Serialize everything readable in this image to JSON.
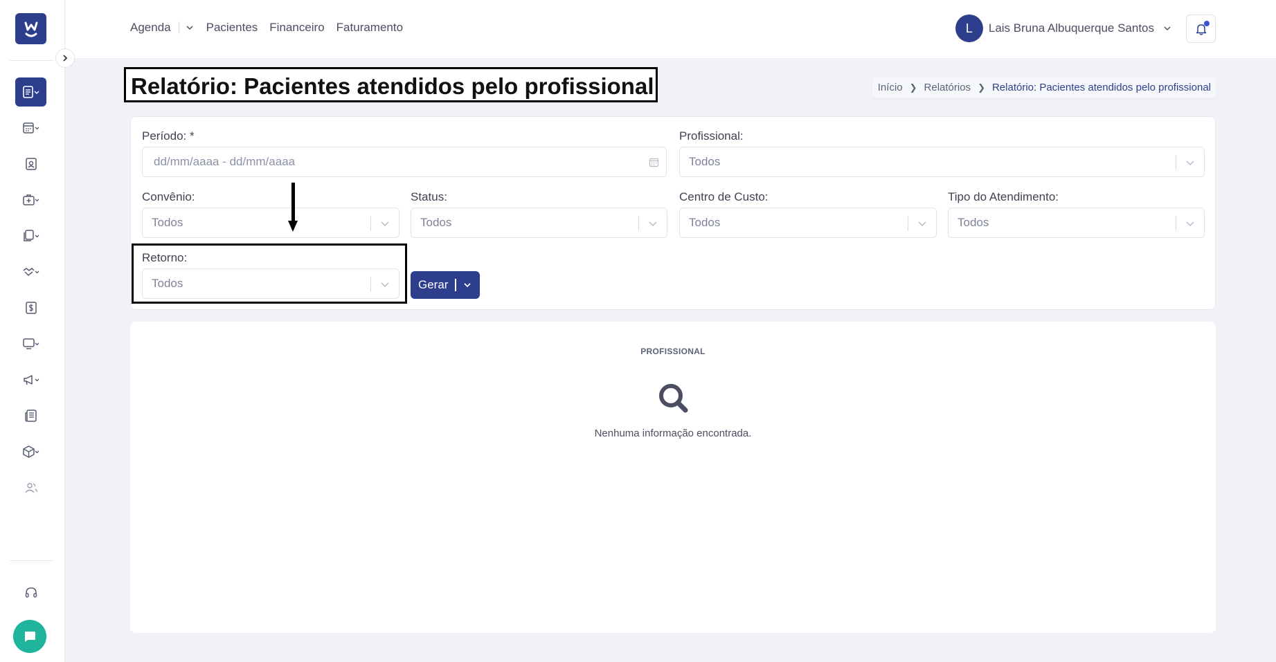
{
  "nav": {
    "items": [
      "Agenda",
      "Pacientes",
      "Financeiro",
      "Faturamento"
    ]
  },
  "user": {
    "initial": "L",
    "name": "Lais Bruna Albuquerque Santos"
  },
  "page": {
    "title": "Relatório: Pacientes atendidos pelo profissional"
  },
  "breadcrumb": [
    "Início",
    "Relatórios",
    "Relatório: Pacientes atendidos pelo profissional"
  ],
  "filters": {
    "periodo_label": "Período: *",
    "periodo_placeholder": "dd/mm/aaaa - dd/mm/aaaa",
    "profissional_label": "Profissional:",
    "profissional_value": "Todos",
    "convenio_label": "Convênio:",
    "convenio_value": "Todos",
    "status_label": "Status:",
    "status_value": "Todos",
    "centro_label": "Centro de Custo:",
    "centro_value": "Todos",
    "tipo_label": "Tipo do Atendimento:",
    "tipo_value": "Todos",
    "retorno_label": "Retorno:",
    "retorno_value": "Todos",
    "gerar_label": "Gerar"
  },
  "results": {
    "header": "PROFISSIONAL",
    "empty_message": "Nenhuma informação encontrada."
  },
  "colors": {
    "primary": "#2d3e8c",
    "chat": "#1fb59d",
    "notification_dot": "#3b50d9"
  },
  "icons": {
    "sidebar": [
      "reports-icon",
      "calendar-icon",
      "patient-card-icon",
      "medical-bag-icon",
      "documents-icon",
      "handshake-icon",
      "dollar-icon",
      "monitor-icon",
      "megaphone-icon",
      "newspaper-icon",
      "box-icon",
      "users-icon",
      "headset-icon"
    ]
  }
}
